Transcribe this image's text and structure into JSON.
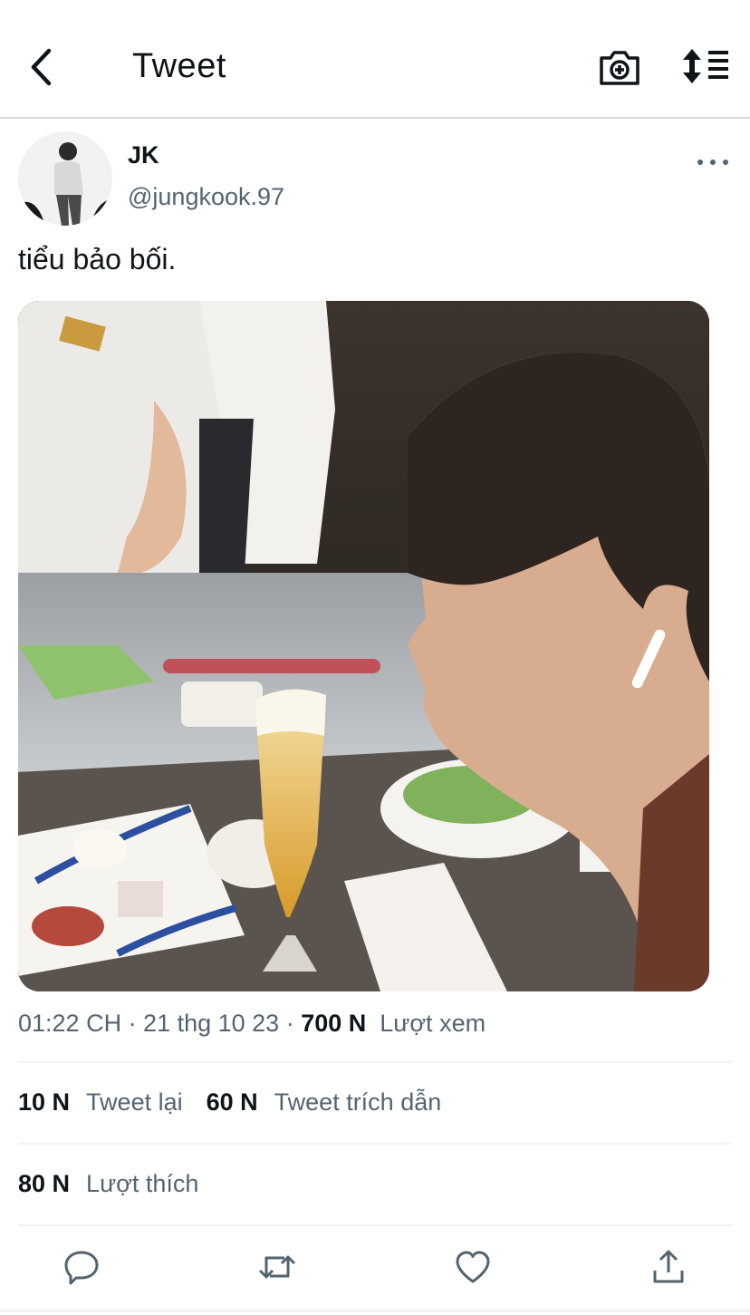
{
  "header": {
    "title": "Tweet",
    "back_icon": "chevron-left-icon",
    "camera_icon": "camera-plus-icon",
    "sort_icon": "sort-list-icon"
  },
  "tweet": {
    "display_name": "JK",
    "handle": "@jungkook.97",
    "text": "tiểu bảo bối.",
    "timestamp": "01:22 CH · 21 thg 10 23 · ",
    "views_count": "700 N",
    "views_label": "Lượt xem"
  },
  "stats": {
    "retweets_count": "10 N",
    "retweets_label": "Tweet lại",
    "quotes_count": "60 N",
    "quotes_label": "Tweet trích dẫn",
    "likes_count": "80 N",
    "likes_label": "Lượt thích"
  },
  "actions": {
    "reply_icon": "reply-bubble-icon",
    "retweet_icon": "retweet-icon",
    "like_icon": "heart-icon",
    "share_icon": "share-upload-icon"
  },
  "colors": {
    "text_primary": "#0f1419",
    "text_secondary": "#536471",
    "divider": "#eff3f4"
  }
}
